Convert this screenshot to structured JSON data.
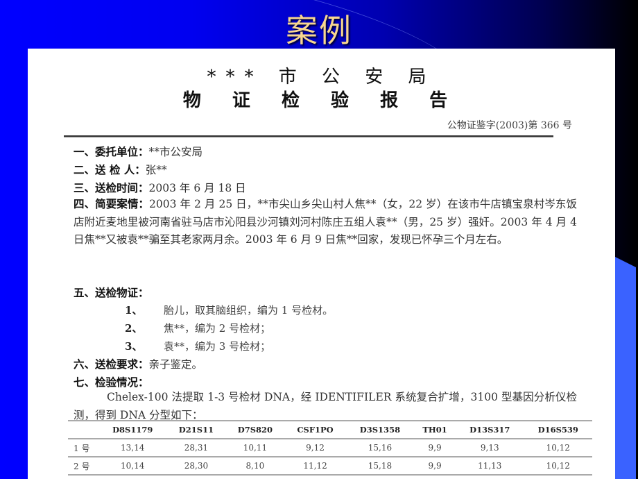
{
  "slide": {
    "title": "案例",
    "colors": {
      "title": "#f7d690",
      "background_start": "#0000ff",
      "background_end": "#000000",
      "stripe": "#3a62ff"
    }
  },
  "document": {
    "heading_line1": "*** 市 公 安 局",
    "heading_line2": "物 证 检 验 报 告",
    "report_number": "公物证鉴字(2003)第 366 号",
    "sections": [
      {
        "label": "一、委托单位：",
        "value": "**市公安局"
      },
      {
        "label": "二、送 检 人：",
        "value": "张**"
      },
      {
        "label": "三、送检时间：",
        "value": "2003 年 6 月 18 日"
      },
      {
        "label": "四、简要案情：",
        "value": "2003 年 2 月 25 日，**市尖山乡尖山村人焦**（女，22 岁）在该市牛店镇宝泉村岑东饭店附近麦地里被河南省驻马店市沁阳县沙河镇刘河村陈庄五组人袁**（男，25 岁）强奸。2003 年 4 月 4 日焦**又被袁**骗至其老家两月余。2003 年 6 月 9 日焦**回家，发现已怀孕三个月左右。"
      },
      {
        "label": "五、送检物证：",
        "value": ""
      },
      {
        "label": "六、送检要求：",
        "value": "亲子鉴定。"
      },
      {
        "label": "七、检验情况：",
        "value": ""
      }
    ],
    "evidence_items": [
      {
        "num": "1、",
        "text": "胎儿，取其脑组织，编为 1 号检材。"
      },
      {
        "num": "2、",
        "text": "焦**，编为 2 号检材；"
      },
      {
        "num": "3、",
        "text": "袁**，编为 3 号检材；"
      }
    ],
    "inspection_text": "Chelex-100 法提取 1-3 号检材 DNA，经 IDENTIFILER 系统复合扩增，3100 型基因分析仪检测，得到 DNA 分型如下："
  },
  "dna_table": {
    "headers": [
      "",
      "D8S1179",
      "D21S11",
      "D7S820",
      "CSF1PO",
      "D3S1358",
      "TH01",
      "D13S317",
      "D16S539"
    ],
    "rows": [
      [
        "1 号",
        "13,14",
        "28,31",
        "10,11",
        "9,12",
        "15,16",
        "9,9",
        "9,13",
        "10,12"
      ],
      [
        "2 号",
        "10,14",
        "28,30",
        "8,10",
        "11,12",
        "15,18",
        "9,9",
        "11,13",
        "10,12"
      ]
    ]
  }
}
